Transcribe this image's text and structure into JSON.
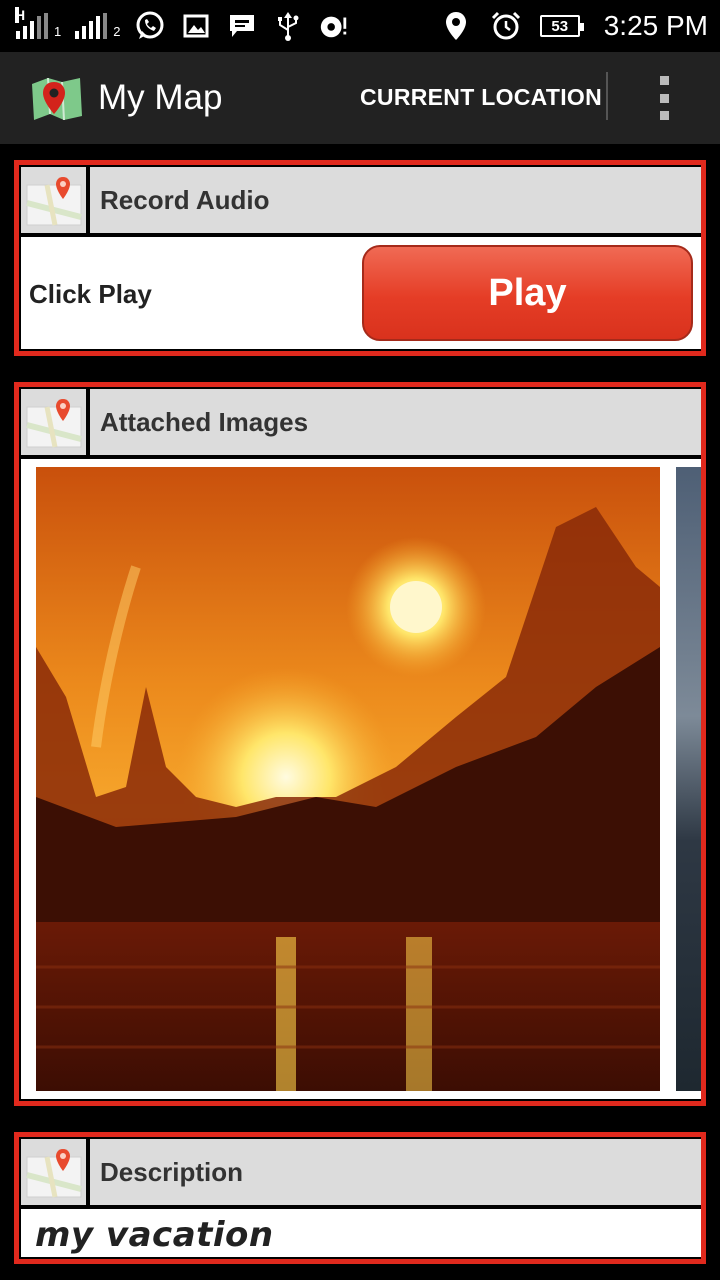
{
  "status_bar": {
    "network_type": "H",
    "sim1_label": "1",
    "sim2_label": "2",
    "battery_level": "53",
    "time": "3:25 PM",
    "icons": [
      "whatsapp-icon",
      "image-icon",
      "message-icon",
      "usb-icon",
      "debug-icon",
      "location-icon",
      "alarm-icon",
      "battery-icon"
    ]
  },
  "action_bar": {
    "app_title": "My Map",
    "current_location_label": "CURRENT LOCATION"
  },
  "audio_card": {
    "title": "Record Audio",
    "instruction": "Click Play",
    "play_label": "Play"
  },
  "images_card": {
    "title": "Attached Images"
  },
  "description_card": {
    "title": "Description",
    "text": "my vacation"
  },
  "colors": {
    "accent_border": "#e0291d",
    "play_button": "#e53d26",
    "header_bg": "#dcdcdc",
    "action_bar_bg": "#222222"
  }
}
